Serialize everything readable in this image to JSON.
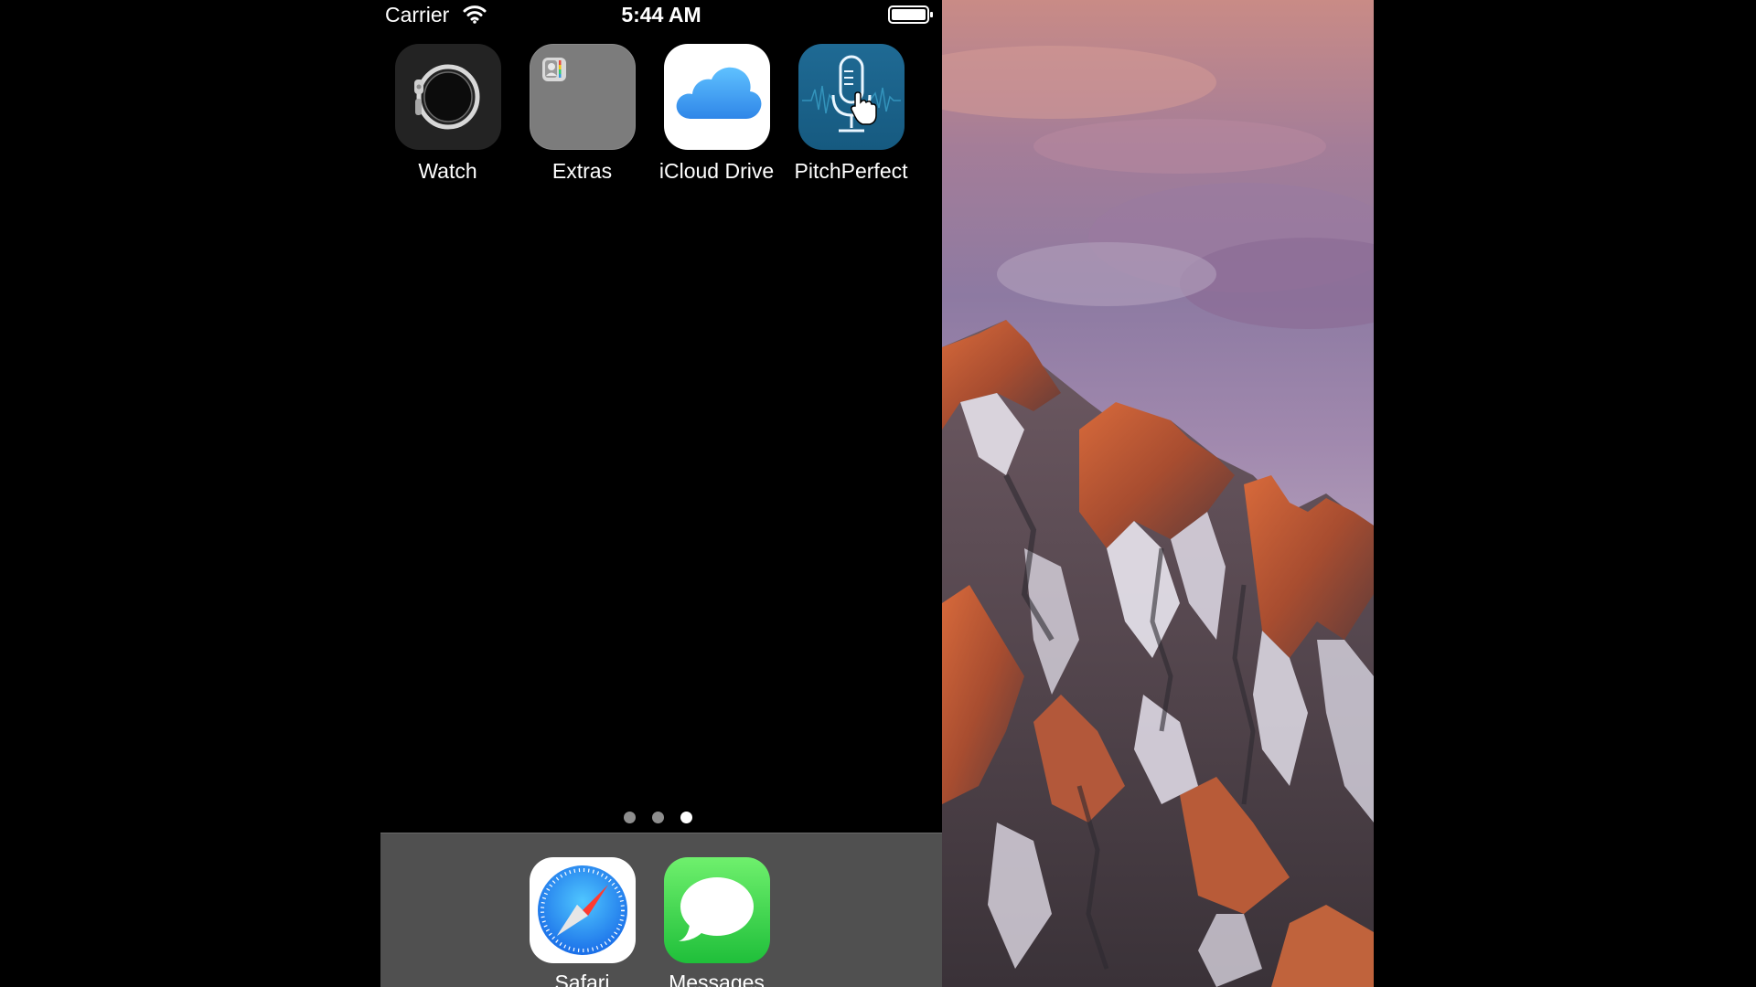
{
  "status_bar": {
    "carrier": "Carrier",
    "time": "5:44 AM",
    "wifi_icon": "wifi-icon",
    "battery_icon": "battery-full-icon"
  },
  "home_screen": {
    "apps": [
      {
        "label": "Watch",
        "icon": "watch-app-icon"
      },
      {
        "label": "Extras",
        "icon": "folder-icon"
      },
      {
        "label": "iCloud Drive",
        "icon": "cloud-icon"
      },
      {
        "label": "PitchPerfect",
        "icon": "microphone-icon"
      }
    ],
    "page_indicator": {
      "pages": 3,
      "current": 3
    }
  },
  "dock": {
    "apps": [
      {
        "label": "Safari",
        "icon": "compass-icon"
      },
      {
        "label": "Messages",
        "icon": "speech-bubble-icon"
      }
    ]
  },
  "colors": {
    "dock_background": "#505050",
    "screen_background": "#000000",
    "pitchperfect_tile": "#1d5f86",
    "messages_green": "#5ed95f",
    "icloud_blue": "#3a9ef0"
  }
}
